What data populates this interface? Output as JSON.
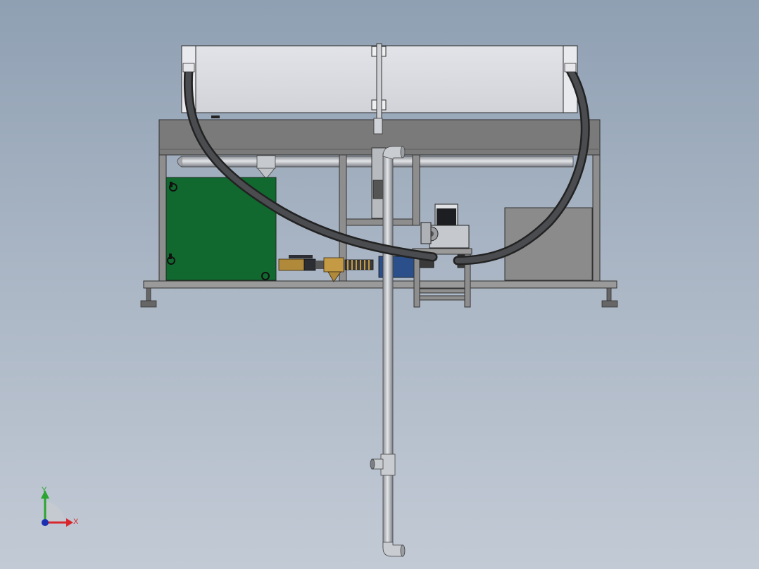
{
  "viewport": {
    "background_top": "#8fa0b3",
    "background_bottom": "#c2cad5"
  },
  "model": {
    "tank_color": "#11692f",
    "frame_color": "#6e6e6e",
    "hood_color": "#dcdde2",
    "hose_color": "#2f3033",
    "pipe_color": "#b9bcc2",
    "panel_color": "#8b8b8b",
    "brass_color": "#b08a3a",
    "pump_color": "#2a4f8a"
  },
  "triad": {
    "x_label": "X",
    "y_label": "Y",
    "x_color": "#d8262c",
    "y_color": "#2aa52f",
    "z_color": "#1b2fb3"
  }
}
